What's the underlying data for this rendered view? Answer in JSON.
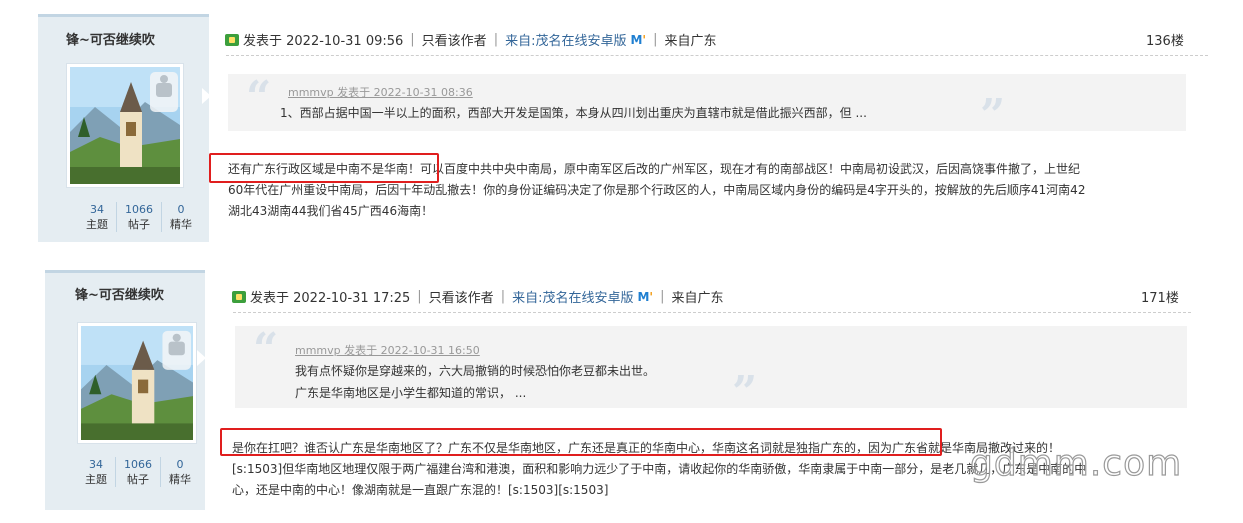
{
  "posts": [
    {
      "username": "锋~可否继续吹",
      "stats": [
        {
          "num": "34",
          "label": "主题"
        },
        {
          "num": "1066",
          "label": "帖子"
        },
        {
          "num": "0",
          "label": "精华"
        }
      ],
      "posted": "发表于 2022-10-31 09:56",
      "only_author": "只看该作者",
      "source": "来自:茂名在线安卓版",
      "region": "来自广东",
      "floor": "136楼",
      "quote_by": "mmmvp 发表于 2022-10-31 08:36",
      "quote_lines": [
        "1、西部占据中国一半以上的面积，西部大开发是国策，本身从四川划出重庆为直辖市就是借此振兴西部，但 ..."
      ],
      "body_lines": [
        "还有广东行政区域是中南不是华南！可以百度中共中央中南局，原中南军区后改的广州军区，现在才有的南部战区！中南局初设武汉，后因高饶事件撤了，上世纪",
        "60年代在广州重设中南局，后因十年动乱撤去！你的身份证编码决定了你是那个行政区的人，中南局区域内身份的编码是4字开头的，按解放的先后顺序41河南42",
        "湖北43湖南44我们省45广西46海南！"
      ]
    },
    {
      "username": "锋~可否继续吹",
      "stats": [
        {
          "num": "34",
          "label": "主题"
        },
        {
          "num": "1066",
          "label": "帖子"
        },
        {
          "num": "0",
          "label": "精华"
        }
      ],
      "posted": "发表于 2022-10-31 17:25",
      "only_author": "只看该作者",
      "source": "来自:茂名在线安卓版",
      "region": "来自广东",
      "floor": "171楼",
      "quote_by": "mmmvp 发表于 2022-10-31 16:50",
      "quote_lines": [
        "我有点怀疑你是穿越来的，六大局撤销的时候恐怕你老豆都未出世。",
        "广东是华南地区是小学生都知道的常识， ..."
      ],
      "body_lines": [
        "是你在扛吧？谁否认广东是华南地区了？广东不仅是华南地区，广东还是真正的华南中心，华南这名词就是独指广东的，因为广东省就是华南局撤改过来的！",
        "[s:1503]但华南地区地理仅限于两广福建台湾和港澳，面积和影响力远少了于中南，请收起你的华南骄傲，华南隶属于中南一部分，是老几就几，广东是中南的中",
        "心，还是中南的中心！像湖南就是一直跟广东混的！[s:1503][s:1503]"
      ]
    }
  ],
  "watermark": "gdmm.com"
}
